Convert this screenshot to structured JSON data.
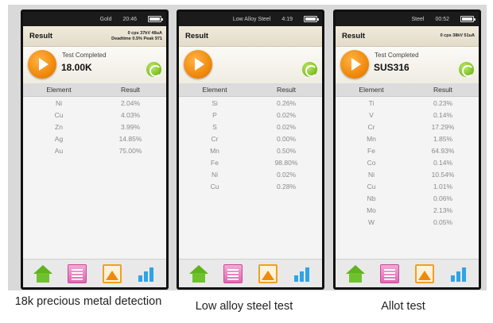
{
  "panels": [
    {
      "status_label": "Gold",
      "clock": "20:46",
      "result_title": "Result",
      "meta_line1": "0 cps 37kV 48uA",
      "meta_line2": "Deadtime 0.5% Peak 971",
      "test_status": "Test Completed",
      "sample_name": "18.00K",
      "col_element": "Element",
      "col_result": "Result",
      "rows": [
        {
          "element": "Ni",
          "result": "2.04%"
        },
        {
          "element": "Cu",
          "result": "4.03%"
        },
        {
          "element": "Zn",
          "result": "3.99%"
        },
        {
          "element": "Ag",
          "result": "14.85%"
        },
        {
          "element": "Au",
          "result": "75.00%"
        }
      ],
      "caption": "18k precious metal detection"
    },
    {
      "status_label": "Low Alloy Steel",
      "clock": "4:19",
      "result_title": "Result",
      "meta_line1": "",
      "meta_line2": "",
      "test_status": "",
      "sample_name": "",
      "col_element": "Element",
      "col_result": "Result",
      "rows": [
        {
          "element": "Si",
          "result": "0.26%"
        },
        {
          "element": "P",
          "result": "0.02%"
        },
        {
          "element": "S",
          "result": "0.02%"
        },
        {
          "element": "Cr",
          "result": "0.00%"
        },
        {
          "element": "Mn",
          "result": "0.50%"
        },
        {
          "element": "Fe",
          "result": "98.80%"
        },
        {
          "element": "Ni",
          "result": "0.02%"
        },
        {
          "element": "Cu",
          "result": "0.28%"
        }
      ],
      "caption": "Low alloy steel test"
    },
    {
      "status_label": "Steel",
      "clock": "00:52",
      "result_title": "Result",
      "meta_line1": "0 cps 38kV 51uA",
      "meta_line2": "",
      "test_status": "Test Completed",
      "sample_name": "SUS316",
      "col_element": "Element",
      "col_result": "Result",
      "rows": [
        {
          "element": "Ti",
          "result": "0.23%"
        },
        {
          "element": "V",
          "result": "0.14%"
        },
        {
          "element": "Cr",
          "result": "17.29%"
        },
        {
          "element": "Mn",
          "result": "1.85%"
        },
        {
          "element": "Fe",
          "result": "64.93%"
        },
        {
          "element": "Co",
          "result": "0.14%"
        },
        {
          "element": "Ni",
          "result": "10.54%"
        },
        {
          "element": "Cu",
          "result": "1.01%"
        },
        {
          "element": "Nb",
          "result": "0.06%"
        },
        {
          "element": "Mo",
          "result": "2.13%"
        },
        {
          "element": "W",
          "result": "0.05%"
        }
      ],
      "caption": "Allot test"
    }
  ],
  "icons": {
    "home": "home-icon",
    "report": "report-icon",
    "spectrum": "spectrum-icon",
    "bars": "bar-chart-icon"
  },
  "colors": {
    "play_button": "#f08a0c",
    "refresh_button": "#7cc022",
    "home_icon": "#5fb31f",
    "report_icon": "#e066b1",
    "bars_icon": "#2fa3e6"
  }
}
